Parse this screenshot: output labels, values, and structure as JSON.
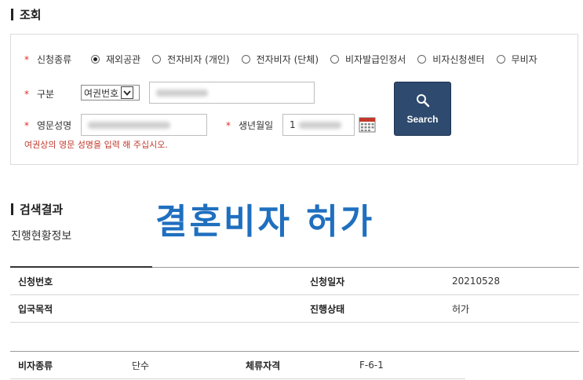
{
  "search_section": {
    "title": "조회"
  },
  "form": {
    "apply_type_label": "신청종류",
    "apply_types": [
      {
        "label": "재외공관",
        "checked": true
      },
      {
        "label": "전자비자 (개인)",
        "checked": false
      },
      {
        "label": "전자비자 (단체)",
        "checked": false
      },
      {
        "label": "비자발급인정서",
        "checked": false
      },
      {
        "label": "비자신청센터",
        "checked": false
      },
      {
        "label": "무비자",
        "checked": false
      }
    ],
    "category_label": "구분",
    "category_select": "여권번호",
    "english_name_label": "영문성명",
    "birthdate_label": "생년월일",
    "birthdate_prefix": "1",
    "hint": "여권상의 영문 성명을 입력 해 주십시오.",
    "search_button": "Search"
  },
  "results_section": {
    "title": "검색결과",
    "overlay_text": "결혼비자 허가",
    "subtitle": "진행현황정보"
  },
  "result_table_1": {
    "rows": [
      {
        "h1": "신청번호",
        "v1": "",
        "h2": "신청일자",
        "v2": "20210528"
      },
      {
        "h1": "입국목적",
        "v1": "",
        "h2": "진행상태",
        "v2": "허가"
      }
    ]
  },
  "result_table_2": {
    "rows": [
      {
        "h1": "비자종류",
        "v1": "단수",
        "h2": "체류자격",
        "v2": "F-6-1"
      }
    ]
  }
}
